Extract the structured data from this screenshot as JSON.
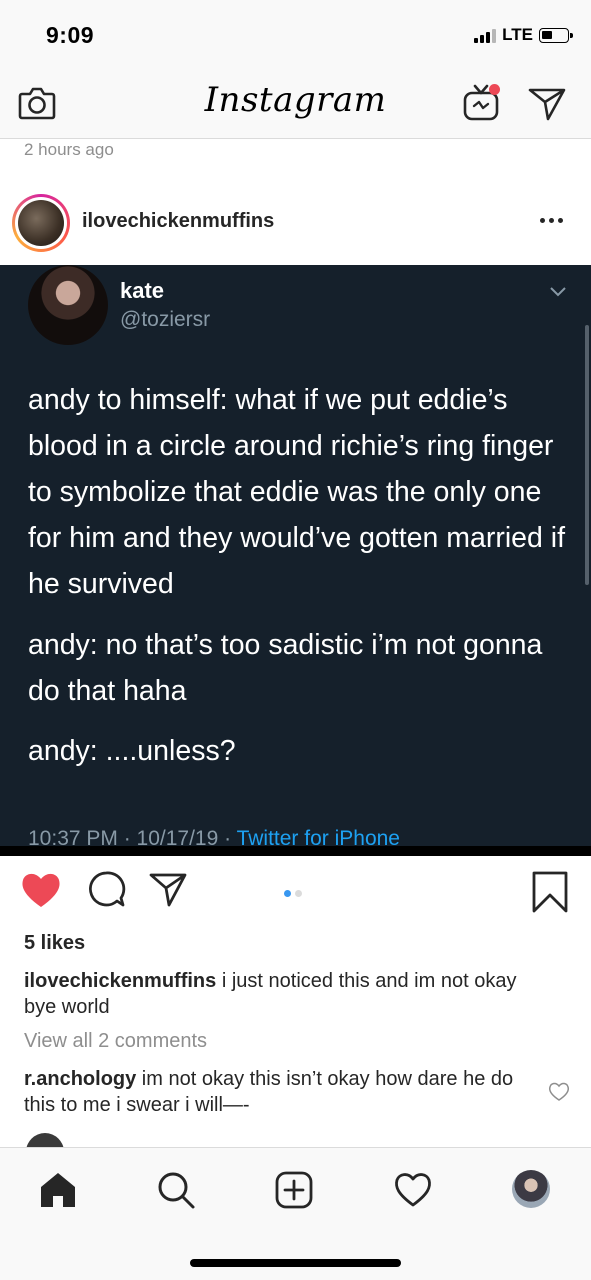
{
  "status_bar": {
    "time": "9:09",
    "network": "LTE"
  },
  "header": {
    "logo": "Instagram",
    "left_icon": "camera-icon",
    "right_icons": [
      "igtv-icon",
      "direct-message-icon"
    ]
  },
  "previous_post_time": "2 hours ago",
  "post": {
    "username": "ilovechickenmuffins",
    "more_icon": "more-options-icon",
    "tweet": {
      "name": "kate",
      "handle": "@toziersr",
      "paragraphs": [
        "andy to himself: what if we put eddie’s blood in a circle around richie’s ring finger to symbolize that eddie was the only one for him and they would’ve gotten married if he survived",
        "andy: no that’s too sadistic i’m not gonna do that haha",
        "andy: ....unless?"
      ],
      "timestamp": "10:37 PM · 10/17/19 · ",
      "source": "Twitter for iPhone"
    },
    "carousel": {
      "count": 2,
      "active_index": 0
    },
    "liked": true,
    "likes_text": "5 likes",
    "caption": {
      "username": "ilovechickenmuffins",
      "text": " i just noticed this and im not okay bye world"
    },
    "view_comments": "View all 2 comments",
    "comments": [
      {
        "username": "r.anchology",
        "text": " im not okay this isn’t okay how dare he do this to me i swear i will—-"
      }
    ]
  },
  "tabbar": {
    "items": [
      "home-icon",
      "search-icon",
      "add-post-icon",
      "activity-heart-icon",
      "profile-avatar"
    ]
  },
  "colors": {
    "like_red": "#ed4956",
    "tweet_bg": "#15202b",
    "tweet_muted": "#8899a6",
    "link_blue": "#1da1f2",
    "carousel_active": "#3897f0"
  }
}
